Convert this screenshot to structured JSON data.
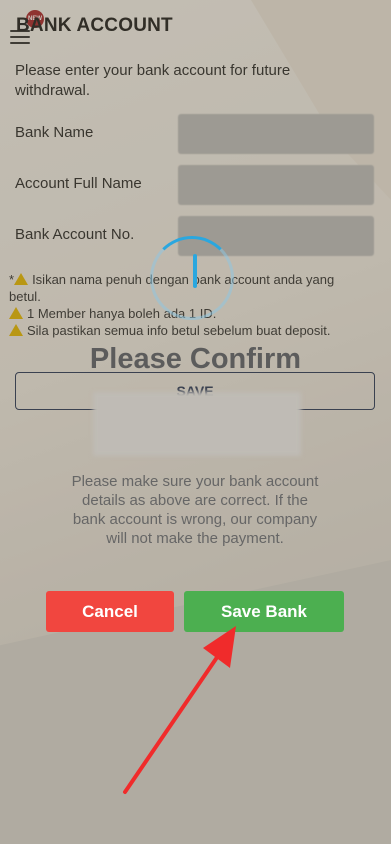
{
  "header": {
    "title": "BANK ACCOUNT",
    "badge": "NEW"
  },
  "form": {
    "intro": "Please enter your bank account for future withdrawal.",
    "bank_name_label": "Bank Name",
    "full_name_label": "Account Full Name",
    "account_no_label": "Bank Account No.",
    "notes": [
      "Isikan nama penuh dengan bank account anda yang betul.",
      "1 Member hanya boleh ada 1 ID.",
      "Sila pastikan semua info betul sebelum buat deposit."
    ],
    "note_prefix": "*",
    "save_label": "SAVE"
  },
  "dialog": {
    "title": "Please Confirm",
    "message": "Please make sure your bank account details as above are correct. If the bank account is wrong, our company will not make the payment.",
    "cancel_label": "Cancel",
    "save_bank_label": "Save Bank"
  },
  "colors": {
    "cancel": "#f1463f",
    "save_bank": "#4caf50",
    "arrow": "#f02b2b",
    "spinner": "#2aa7df"
  },
  "icons": {
    "menu": "menu-icon",
    "warning": "warning-icon",
    "spinner": "loading-spinner-icon",
    "arrow": "annotation-arrow-icon"
  }
}
